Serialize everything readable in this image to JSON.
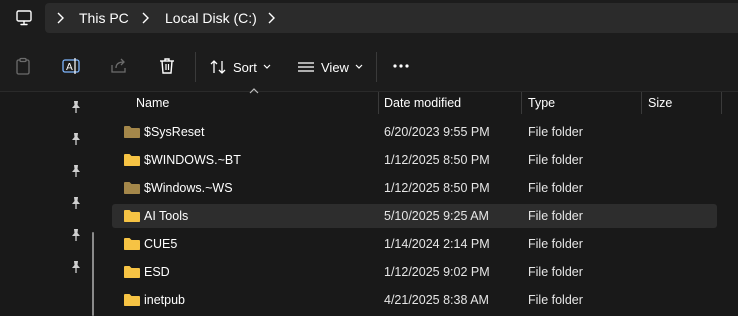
{
  "breadcrumb": {
    "items": [
      "This PC",
      "Local Disk (C:)"
    ]
  },
  "toolbar": {
    "sort_label": "Sort",
    "view_label": "View"
  },
  "columns": {
    "name": "Name",
    "date": "Date modified",
    "type": "Type",
    "size": "Size"
  },
  "files": [
    {
      "name": "$SysReset",
      "date": "6/20/2023 9:55 PM",
      "type": "File folder",
      "hidden": true
    },
    {
      "name": "$WINDOWS.~BT",
      "date": "1/12/2025 8:50 PM",
      "type": "File folder",
      "hidden": false
    },
    {
      "name": "$Windows.~WS",
      "date": "1/12/2025 8:50 PM",
      "type": "File folder",
      "hidden": true
    },
    {
      "name": "AI Tools",
      "date": "5/10/2025 9:25 AM",
      "type": "File folder",
      "hidden": false,
      "selected": true
    },
    {
      "name": "CUE5",
      "date": "1/14/2024 2:14 PM",
      "type": "File folder",
      "hidden": false
    },
    {
      "name": "ESD",
      "date": "1/12/2025 9:02 PM",
      "type": "File folder",
      "hidden": false
    },
    {
      "name": "inetpub",
      "date": "4/21/2025 8:38 AM",
      "type": "File folder",
      "hidden": false
    }
  ],
  "colors": {
    "folder": "#f6c344",
    "folder_hidden": "#a4874a",
    "selected_row": "#2d2d2d"
  },
  "icons": [
    "pc-icon",
    "chevron-right-icon",
    "paste-icon",
    "rename-icon",
    "share-icon",
    "delete-icon",
    "sort-icon",
    "view-icon",
    "more-icon",
    "pin-icon",
    "folder-icon"
  ]
}
